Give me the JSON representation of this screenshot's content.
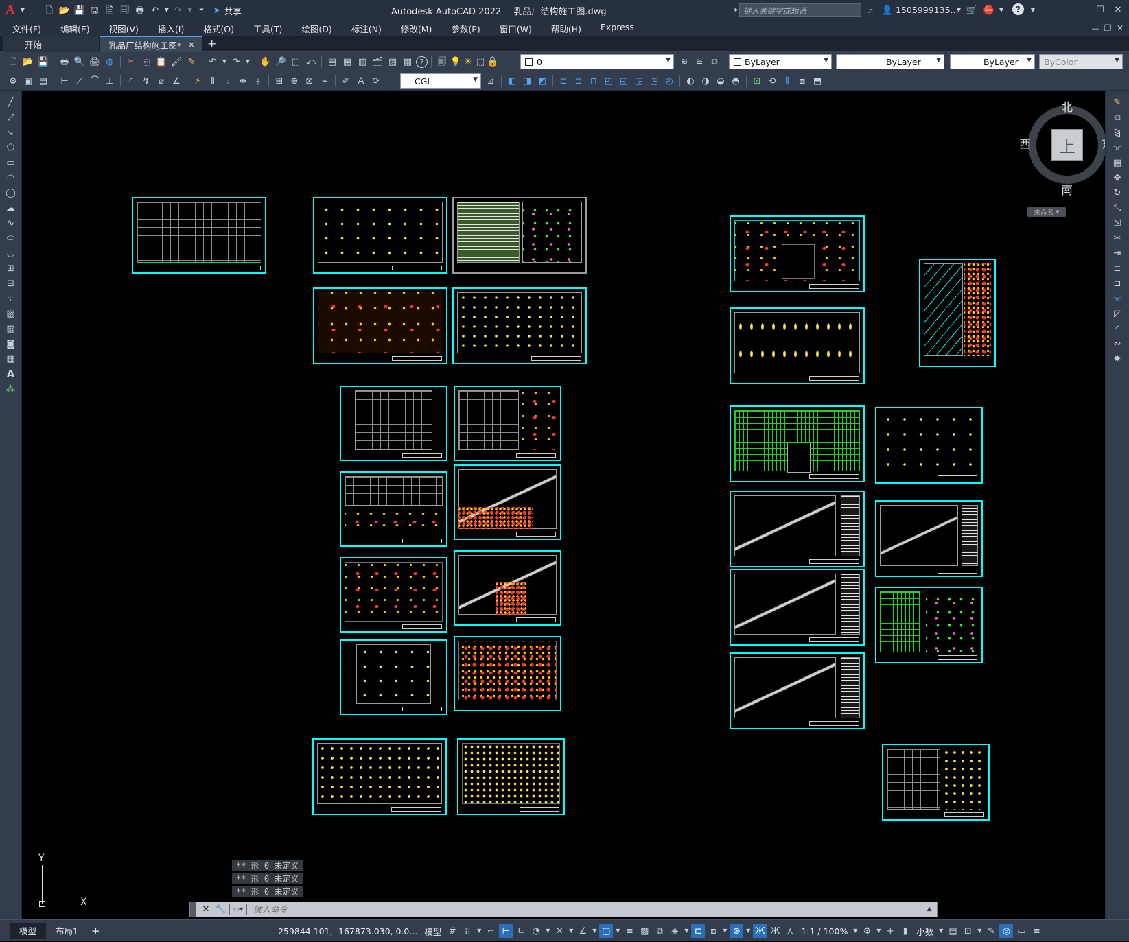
{
  "app": {
    "logo": "A",
    "title": "Autodesk AutoCAD 2022",
    "doc_title": "乳品厂结构施工图.dwg",
    "share_label": "共享",
    "search_placeholder": "键入关键字或短语",
    "user": "1505999135...",
    "window_controls": {
      "minimize": "—",
      "restore": "☐",
      "close": "✕"
    },
    "doc_controls": {
      "minimize": "—",
      "restore": "❐",
      "close": "✕"
    }
  },
  "menus": [
    "文件(F)",
    "编辑(E)",
    "视图(V)",
    "插入(I)",
    "格式(O)",
    "工具(T)",
    "绘图(D)",
    "标注(N)",
    "修改(M)",
    "参数(P)",
    "窗口(W)",
    "帮助(H)",
    "Express"
  ],
  "tabs": [
    {
      "label": "开始",
      "active": false
    },
    {
      "label": "乳品厂结构施工图*",
      "active": true
    }
  ],
  "tab_add": "+",
  "tab_close": "✕",
  "toolbar1": {
    "layer_value": "0",
    "color_value": "ByLayer",
    "linetype_value": "ByLayer",
    "lineweight_value": "ByLayer",
    "plotstyle_value": "ByColor"
  },
  "toolbar2": {
    "textstyle_value": "CGL"
  },
  "viewcube": {
    "north": "北",
    "south": "南",
    "east": "东",
    "west": "西",
    "face": "上",
    "wcs": "未命名"
  },
  "ucs": {
    "x": "X",
    "y": "Y"
  },
  "command_history": [
    "** 形 0 未定义",
    "** 形 0 未定义",
    "** 形 0 未定义"
  ],
  "command_placeholder": "键入命令",
  "layout_tabs": [
    {
      "label": "模型",
      "active": true
    },
    {
      "label": "布局1",
      "active": false
    }
  ],
  "layout_add": "+",
  "status": {
    "coords": "259844.101, -167873.030, 0.0...",
    "mode": "模型",
    "scale": "1:1 / 100%",
    "units": "小数"
  },
  "colors": {
    "frame": "#27303e",
    "toolbar": "#333d4d",
    "sheet_border": "#00ffff",
    "canvas": "#000000"
  }
}
